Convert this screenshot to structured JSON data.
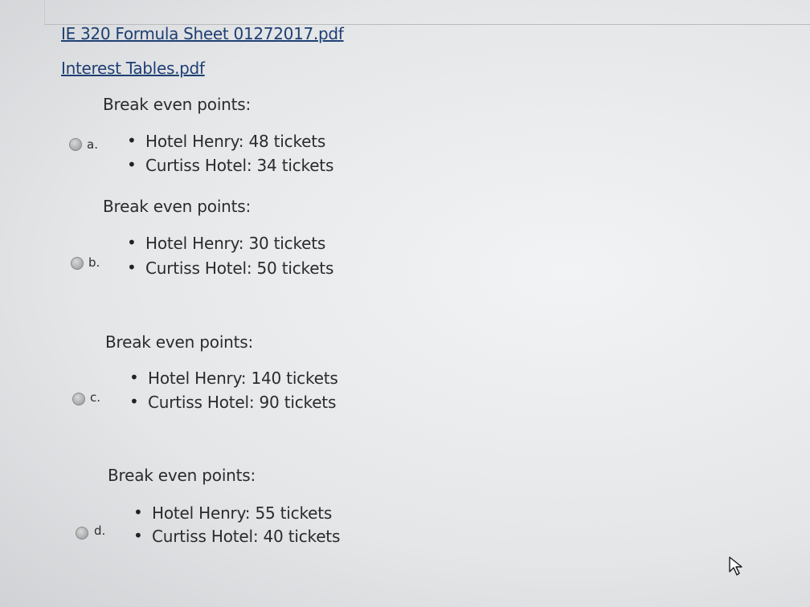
{
  "files": {
    "formula_sheet": "IE 320 Formula Sheet 01272017.pdf",
    "interest_tables": "Interest Tables.pdf"
  },
  "options": [
    {
      "letter": "a.",
      "heading": "Break even points:",
      "items": [
        "Hotel Henry: 48 tickets",
        "Curtiss Hotel: 34 tickets"
      ]
    },
    {
      "letter": "b.",
      "heading": "Break even points:",
      "items": [
        "Hotel Henry: 30 tickets",
        "Curtiss Hotel: 50 tickets"
      ]
    },
    {
      "letter": "c.",
      "heading": "Break even points:",
      "items": [
        "Hotel Henry: 140 tickets",
        "Curtiss Hotel: 90 tickets"
      ]
    },
    {
      "letter": "d.",
      "heading": "Break even points:",
      "items": [
        "Hotel Henry: 55 tickets",
        "Curtiss Hotel: 40 tickets"
      ]
    }
  ],
  "icons": {
    "cursor": "mouse-pointer-icon",
    "bullet": "bullet-dot"
  }
}
